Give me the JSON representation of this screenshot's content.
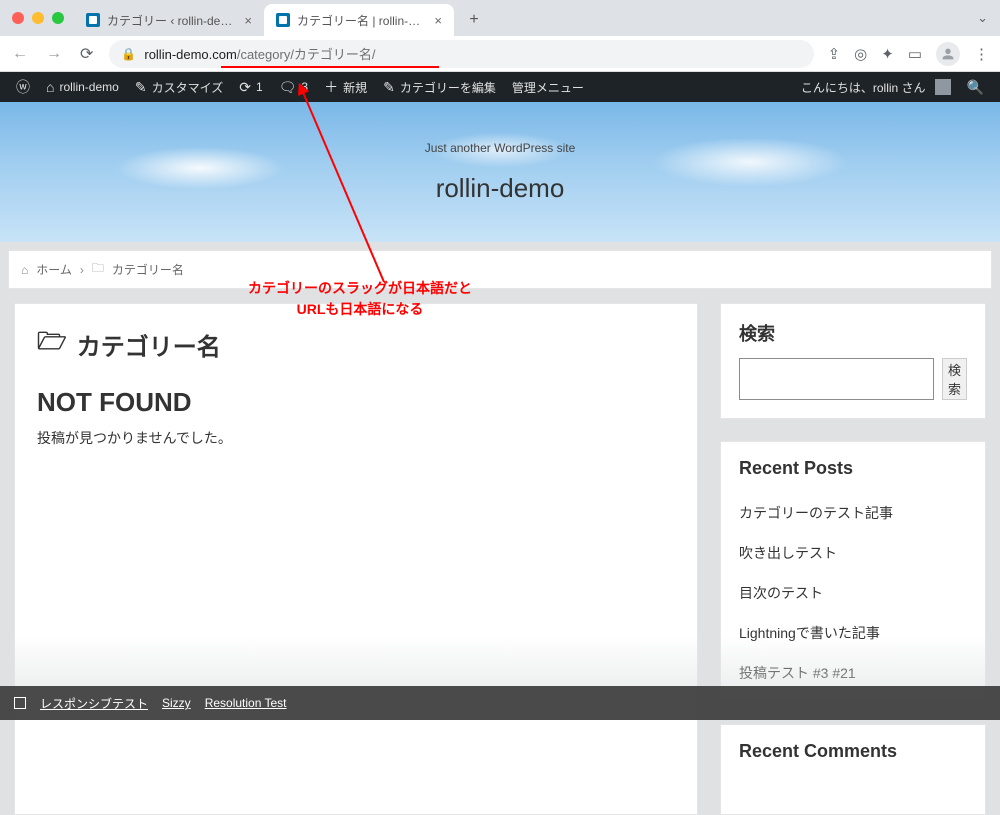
{
  "browser": {
    "tabs": [
      {
        "title": "カテゴリー ‹ rollin-demo — Wor",
        "active": false
      },
      {
        "title": "カテゴリー名 | rollin-demo",
        "active": true
      }
    ],
    "url_host": "rollin-demo.com",
    "url_path": "/category/カテゴリー名/"
  },
  "wpadmin": {
    "site": "rollin-demo",
    "customize": "カスタマイズ",
    "updates": "1",
    "comments": "3",
    "new": "新規",
    "edit_cat": "カテゴリーを編集",
    "admin_menu": "管理メニュー",
    "greeting": "こんにちは、rollin さん"
  },
  "hero": {
    "tagline": "Just another WordPress site",
    "title": "rollin-demo"
  },
  "breadcrumb": {
    "home": "ホーム",
    "current": "カテゴリー名"
  },
  "main": {
    "category_title": "カテゴリー名",
    "not_found": "NOT FOUND",
    "not_found_text": "投稿が見つかりませんでした。"
  },
  "sidebar": {
    "search_label": "検索",
    "search_button": "検索",
    "recent_title": "Recent Posts",
    "recent_items": [
      "カテゴリーのテスト記事",
      "吹き出しテスト",
      "目次のテスト",
      "Lightningで書いた記事",
      "投稿テスト #3 #21"
    ],
    "recent_comments_title": "Recent Comments"
  },
  "devbar": {
    "responsive": "レスポンシブテスト",
    "sizzy": "Sizzy",
    "resolution": "Resolution Test"
  },
  "annotation": {
    "line1": "カテゴリーのスラッグが日本語だと",
    "line2": "URLも日本語になる"
  }
}
